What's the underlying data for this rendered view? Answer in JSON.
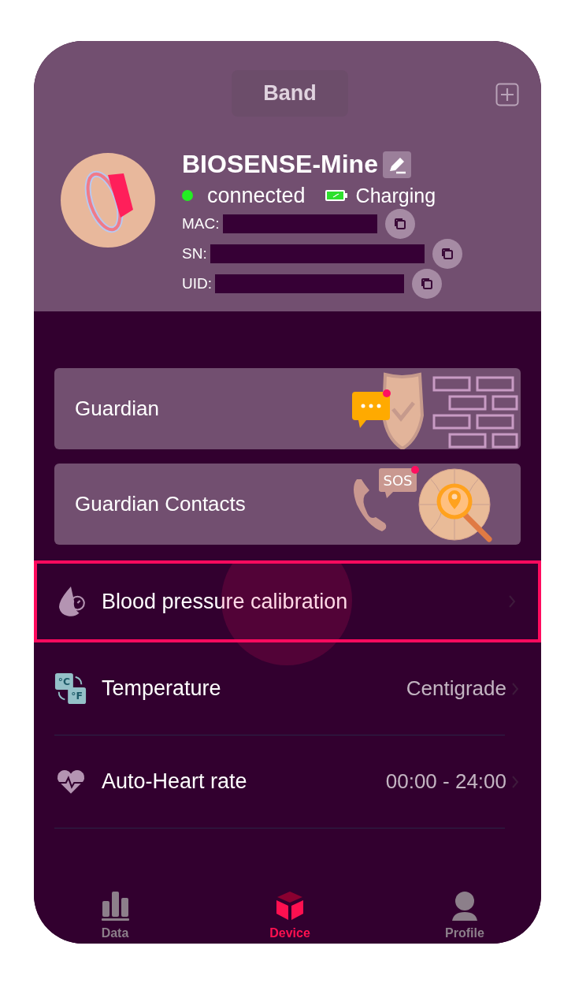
{
  "header": {
    "title": "Band",
    "device_name": "BIOSENSE-Mine",
    "status": {
      "label": "connected",
      "color": "#22ee22"
    },
    "battery": {
      "label": "Charging"
    },
    "ids": [
      {
        "label": "MAC:"
      },
      {
        "label": "SN:"
      },
      {
        "label": "UID:"
      }
    ]
  },
  "cards": [
    {
      "label": "Guardian",
      "kind": "shield"
    },
    {
      "label": "Guardian Contacts",
      "kind": "sos",
      "badge": "SOS"
    }
  ],
  "settings": [
    {
      "label": "Blood pressure calibration",
      "kind": "drop",
      "selected": true
    },
    {
      "label": "Temperature",
      "kind": "temp",
      "icon_text": [
        "°C",
        "°F"
      ],
      "value": "Centigrade",
      "selected": false
    },
    {
      "label": "Auto-Heart rate",
      "kind": "heart",
      "value": "00:00 - 24:00",
      "selected": false
    }
  ],
  "tabs": [
    {
      "label": "Data",
      "kind": "chart",
      "selected": false
    },
    {
      "label": "Device",
      "kind": "cube",
      "selected": true
    },
    {
      "label": "Profile",
      "kind": "person",
      "selected": false
    }
  ]
}
